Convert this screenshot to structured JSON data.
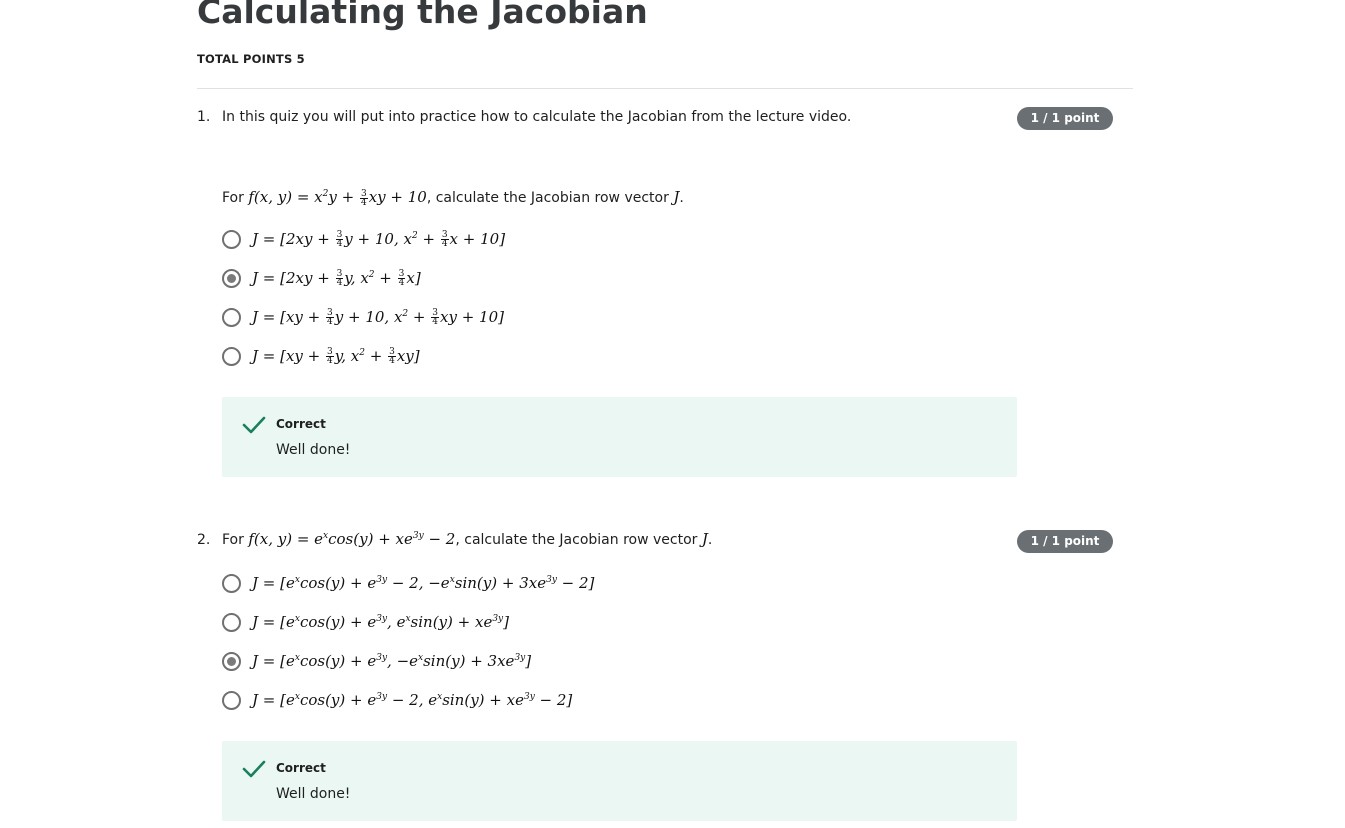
{
  "quiz": {
    "title": "Calculating the Jacobian",
    "total_points": "TOTAL POINTS 5"
  },
  "questions": [
    {
      "number": "1.",
      "intro": "In this quiz you will put into practice how to calculate the Jacobian from the lecture video.",
      "prompt_prefix": "For",
      "prompt_suffix": ", calculate the Jacobian row vector",
      "prompt_var": "J",
      "points": "1 / 1 point",
      "options": [
        {
          "selected": false
        },
        {
          "selected": true
        },
        {
          "selected": false
        },
        {
          "selected": false
        }
      ],
      "feedback": {
        "status": "Correct",
        "message": "Well done!"
      }
    },
    {
      "number": "2.",
      "prompt_prefix": "For",
      "prompt_suffix": ", calculate the Jacobian row vector",
      "prompt_var": "J",
      "points": "1 / 1 point",
      "options": [
        {
          "selected": false
        },
        {
          "selected": false
        },
        {
          "selected": true
        },
        {
          "selected": false
        }
      ],
      "feedback": {
        "status": "Correct",
        "message": "Well done!"
      }
    }
  ],
  "colors": {
    "correct_bg": "#eaf7f3",
    "check": "#1a7f5a",
    "badge": "#6a6f73"
  },
  "icons": {
    "correct": "checkmark-icon"
  }
}
